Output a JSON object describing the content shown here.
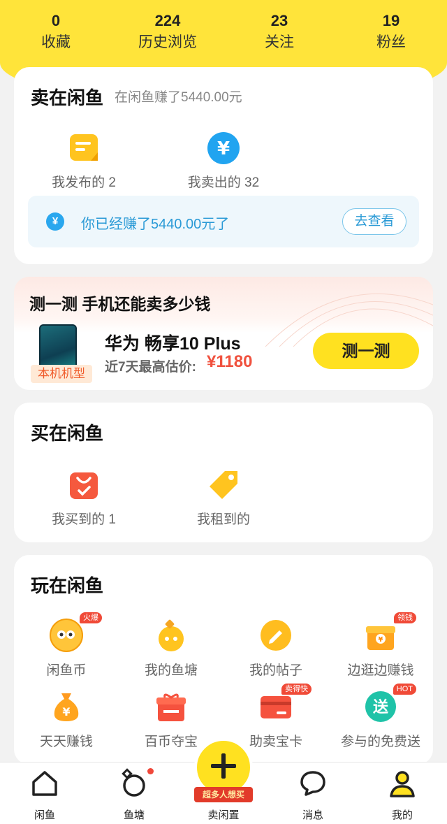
{
  "stats": [
    {
      "num": "0",
      "label": "收藏"
    },
    {
      "num": "224",
      "label": "历史浏览"
    },
    {
      "num": "23",
      "label": "关注"
    },
    {
      "num": "19",
      "label": "粉丝"
    }
  ],
  "sell": {
    "title": "卖在闲鱼",
    "subtitle": "在闲鱼赚了5440.00元",
    "items": [
      {
        "label": "我发布的 2",
        "icon": "note-icon"
      },
      {
        "label": "我卖出的 32",
        "icon": "yen-coin-icon"
      }
    ],
    "banner_icon": "¥",
    "banner_text": "你已经赚了5440.00元了",
    "banner_button": "去查看"
  },
  "test": {
    "title": "测一测 手机还能卖多少钱",
    "tag": "本机机型",
    "model": "华为 畅享10 Plus",
    "price_label": "近7天最高估价:",
    "price": "¥1180",
    "button": "测一测"
  },
  "buy": {
    "title": "买在闲鱼",
    "items": [
      {
        "label": "我买到的 1",
        "icon": "bag-check-icon"
      },
      {
        "label": "我租到的",
        "icon": "tag-icon"
      }
    ]
  },
  "play": {
    "title": "玩在闲鱼",
    "items": [
      {
        "label": "闲鱼币",
        "icon": "fish-coin-icon",
        "badge": "火爆"
      },
      {
        "label": "我的鱼塘",
        "icon": "pond-icon",
        "badge": ""
      },
      {
        "label": "我的帖子",
        "icon": "pen-icon",
        "badge": ""
      },
      {
        "label": "边逛边赚钱",
        "icon": "money-box-icon",
        "badge": "领钱"
      },
      {
        "label": "天天赚钱",
        "icon": "money-bag-icon",
        "badge": ""
      },
      {
        "label": "百币夺宝",
        "icon": "gift-icon",
        "badge": ""
      },
      {
        "label": "助卖宝卡",
        "icon": "card-icon",
        "badge": "卖得快"
      },
      {
        "label": "参与的免费送",
        "icon": "free-give-icon",
        "badge": "HOT"
      }
    ]
  },
  "tabs": [
    {
      "label": "闲鱼",
      "icon": "home-icon"
    },
    {
      "label": "鱼塘",
      "icon": "pond-tab-icon"
    },
    {
      "label": "卖闲置",
      "icon": "plus-icon"
    },
    {
      "label": "消息",
      "icon": "chat-icon"
    },
    {
      "label": "我的",
      "icon": "person-icon"
    }
  ],
  "sell_promo": "超多人想买",
  "colors": {
    "brand": "#ffe120",
    "price": "#f0513e",
    "link": "#2a9ad6"
  }
}
